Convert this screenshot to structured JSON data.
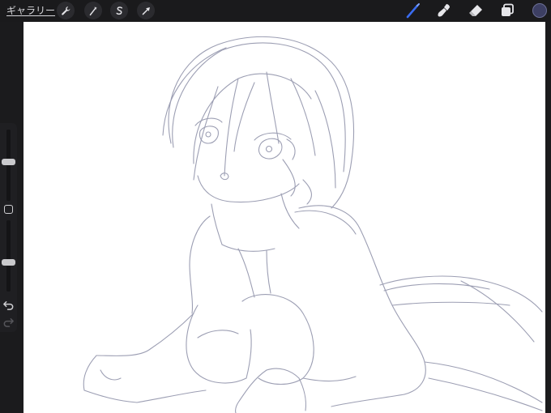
{
  "toolbar": {
    "gallery_label": "ギャラリー",
    "left_tools": [
      {
        "icon": "wrench-icon",
        "name": "actions"
      },
      {
        "icon": "magic-wand-icon",
        "name": "adjustments"
      },
      {
        "icon": "selection-s-icon",
        "name": "selection"
      },
      {
        "icon": "arrow-cursor-icon",
        "name": "transform"
      }
    ],
    "right_tools": [
      {
        "icon": "brush-icon",
        "name": "paint",
        "active": true
      },
      {
        "icon": "smudge-icon",
        "name": "smudge"
      },
      {
        "icon": "eraser-icon",
        "name": "erase"
      },
      {
        "icon": "layers-icon",
        "name": "layers"
      }
    ],
    "current_color": "#3d3f63",
    "active_tool_color": "#3a6cf0"
  },
  "sidebar": {
    "brush_size_level": 0.55,
    "opacity_level": 0.4
  },
  "canvas": {
    "background": "#ffffff",
    "sketch_stroke_color": "#8b8ea6"
  }
}
